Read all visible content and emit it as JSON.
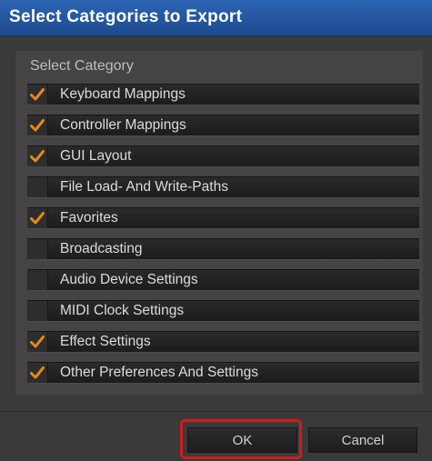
{
  "window": {
    "title": "Select Categories to Export"
  },
  "section_label": "Select Category",
  "categories": [
    {
      "label": "Keyboard Mappings",
      "checked": true
    },
    {
      "label": "Controller Mappings",
      "checked": true
    },
    {
      "label": "GUI Layout",
      "checked": true
    },
    {
      "label": "File Load- And Write-Paths",
      "checked": false
    },
    {
      "label": "Favorites",
      "checked": true
    },
    {
      "label": "Broadcasting",
      "checked": false
    },
    {
      "label": "Audio Device Settings",
      "checked": false
    },
    {
      "label": "MIDI Clock Settings",
      "checked": false
    },
    {
      "label": "Effect Settings",
      "checked": true
    },
    {
      "label": "Other Preferences And Settings",
      "checked": true
    }
  ],
  "buttons": {
    "ok_label": "OK",
    "cancel_label": "Cancel"
  },
  "colors": {
    "title_bar": "#245aa6",
    "checkmark": "#e8861c",
    "highlight": "#d8181f"
  }
}
